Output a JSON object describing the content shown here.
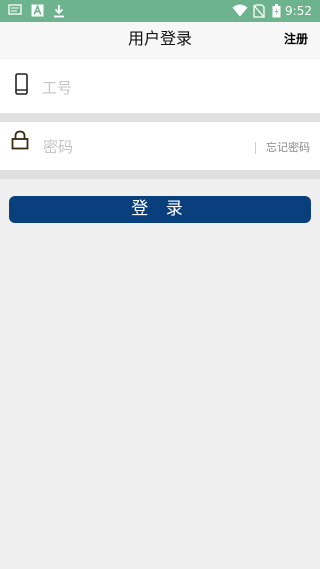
{
  "status_bar": {
    "time": "9:52",
    "icons": [
      "message-icon",
      "a-icon",
      "download-icon",
      "wifi-icon",
      "no-sim-icon",
      "battery-icon"
    ]
  },
  "header": {
    "title": "用户登录",
    "register_label": "注册"
  },
  "form": {
    "employee_id": {
      "placeholder": "工号",
      "value": "",
      "icon": "phone-icon"
    },
    "password": {
      "placeholder": "密码",
      "value": "",
      "icon": "lock-icon"
    },
    "forgot_label": "忘记密码"
  },
  "login_button": {
    "label": "登 录"
  },
  "colors": {
    "status_bar": "#6db38d",
    "button": "#0a3f7d",
    "background": "#efefef"
  }
}
